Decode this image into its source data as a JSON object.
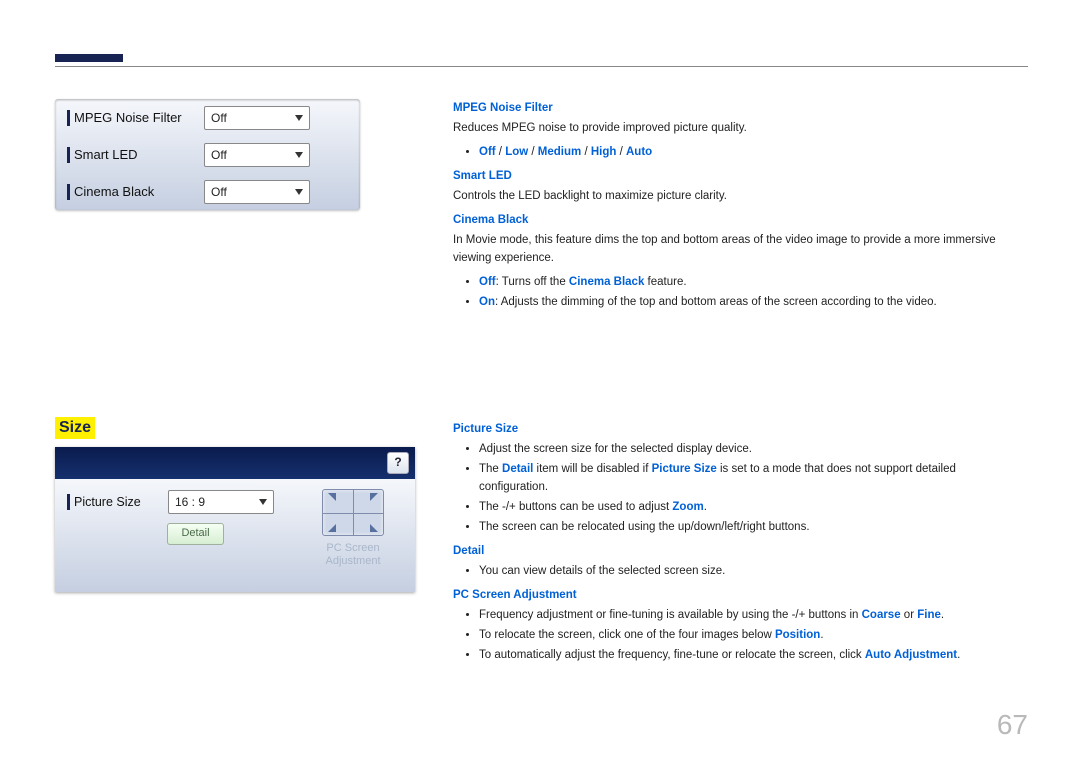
{
  "page_number": "67",
  "section2_title": "Size",
  "panel1": {
    "rows": [
      {
        "label": "MPEG Noise Filter",
        "value": "Off"
      },
      {
        "label": "Smart LED",
        "value": "Off"
      },
      {
        "label": "Cinema Black",
        "value": "Off"
      }
    ]
  },
  "panel2": {
    "help_icon": "?",
    "picture_size_label": "Picture Size",
    "picture_size_value": "16 : 9",
    "detail_btn": "Detail",
    "pc_label_line1": "PC Screen",
    "pc_label_line2": "Adjustment"
  },
  "doc1": {
    "h_mpeg": "MPEG Noise Filter",
    "p_mpeg": "Reduces MPEG noise to provide improved picture quality.",
    "opts": {
      "off": "Off",
      "low": "Low",
      "medium": "Medium",
      "high": "High",
      "auto": "Auto",
      "sep": " / "
    },
    "h_smart": "Smart LED",
    "p_smart": "Controls the LED backlight to maximize picture clarity.",
    "h_cinema": "Cinema Black",
    "p_cinema": "In Movie mode, this feature dims the top and bottom areas of the video image to provide a more immersive viewing experience.",
    "cb_off_k": "Off",
    "cb_off_t": ": Turns off the ",
    "cb_off_k2": "Cinema Black",
    "cb_off_t2": " feature.",
    "cb_on_k": "On",
    "cb_on_t": ": Adjusts the dimming of the top and bottom areas of the screen according to the video."
  },
  "doc2": {
    "h_ps": "Picture Size",
    "ps1": "Adjust the screen size for the selected display device.",
    "ps2a": "The ",
    "ps2k1": "Detail",
    "ps2b": " item will be disabled if ",
    "ps2k2": "Picture Size",
    "ps2c": " is set to a mode that does not support detailed configuration.",
    "ps3a": "The -/+ buttons can be used to adjust ",
    "ps3k": "Zoom",
    "ps3b": ".",
    "ps4": "The screen can be relocated using the up/down/left/right buttons.",
    "h_detail": "Detail",
    "d1": "You can view details of the selected screen size.",
    "h_pc": "PC Screen Adjustment",
    "pc1a": "Frequency adjustment or fine-tuning is available by using the -/+ buttons in ",
    "pc1k1": "Coarse",
    "pc1b": " or ",
    "pc1k2": "Fine",
    "pc1c": ".",
    "pc2a": "To relocate the screen, click one of the four images below ",
    "pc2k": "Position",
    "pc2b": ".",
    "pc3a": "To automatically adjust the frequency, fine-tune or relocate the screen, click ",
    "pc3k": "Auto Adjustment",
    "pc3b": "."
  }
}
